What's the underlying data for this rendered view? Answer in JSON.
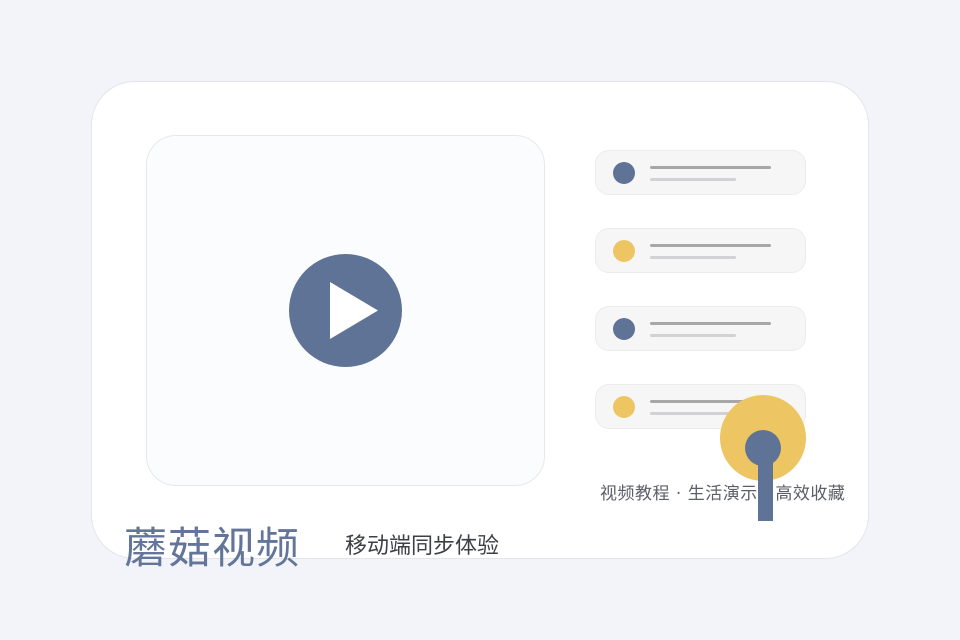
{
  "brand": {
    "name": "蘑菇视频",
    "slogan": "移动端同步体验"
  },
  "tags": "视频教程 · 生活演示 · 高效收藏",
  "video": {
    "play_icon": "play-icon"
  },
  "list": [
    {
      "dot_color": "#5f7396"
    },
    {
      "dot_color": "#eec563"
    },
    {
      "dot_color": "#5f7396"
    },
    {
      "dot_color": "#eec563"
    }
  ],
  "colors": {
    "accent_blue": "#5f7396",
    "accent_yellow": "#eec563",
    "background": "#f2f4fa"
  },
  "overlay_icon": "tap-pointer-icon"
}
